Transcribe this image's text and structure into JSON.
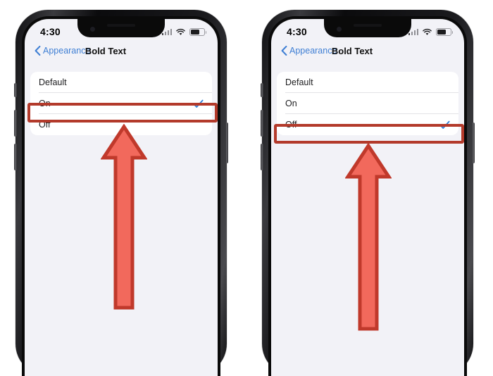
{
  "meta": {
    "accent_blue": "#3f7fd4",
    "check_blue": "#2f7fd6",
    "highlight_red": "#b33a2b",
    "arrow_fill": "#f2695c",
    "arrow_stroke": "#c0392b",
    "screen_bg": "#f2f2f7",
    "card_bg": "#ffffff"
  },
  "phones": [
    {
      "id": "left",
      "status": {
        "time": "4:30",
        "cellular_icon": "cellular-signal-icon",
        "wifi_icon": "wifi-icon",
        "battery_icon": "battery-icon",
        "battery_level_percent": 62
      },
      "nav": {
        "back_icon": "chevron-left-icon",
        "back_label": "Appearance",
        "title": "Bold Text"
      },
      "options": [
        {
          "label": "Default",
          "selected": false
        },
        {
          "label": "On",
          "selected": true
        },
        {
          "label": "Off",
          "selected": false
        }
      ],
      "highlighted_index": 1,
      "annotation": {
        "arrow_icon": "up-arrow-annotation",
        "points_to": "On"
      }
    },
    {
      "id": "right",
      "status": {
        "time": "4:30",
        "cellular_icon": "cellular-signal-icon",
        "wifi_icon": "wifi-icon",
        "battery_icon": "battery-icon",
        "battery_level_percent": 62
      },
      "nav": {
        "back_icon": "chevron-left-icon",
        "back_label": "Appearance",
        "title": "Bold Text"
      },
      "options": [
        {
          "label": "Default",
          "selected": false
        },
        {
          "label": "On",
          "selected": false
        },
        {
          "label": "Off",
          "selected": true
        }
      ],
      "highlighted_index": 2,
      "annotation": {
        "arrow_icon": "up-arrow-annotation",
        "points_to": "Off"
      }
    }
  ]
}
